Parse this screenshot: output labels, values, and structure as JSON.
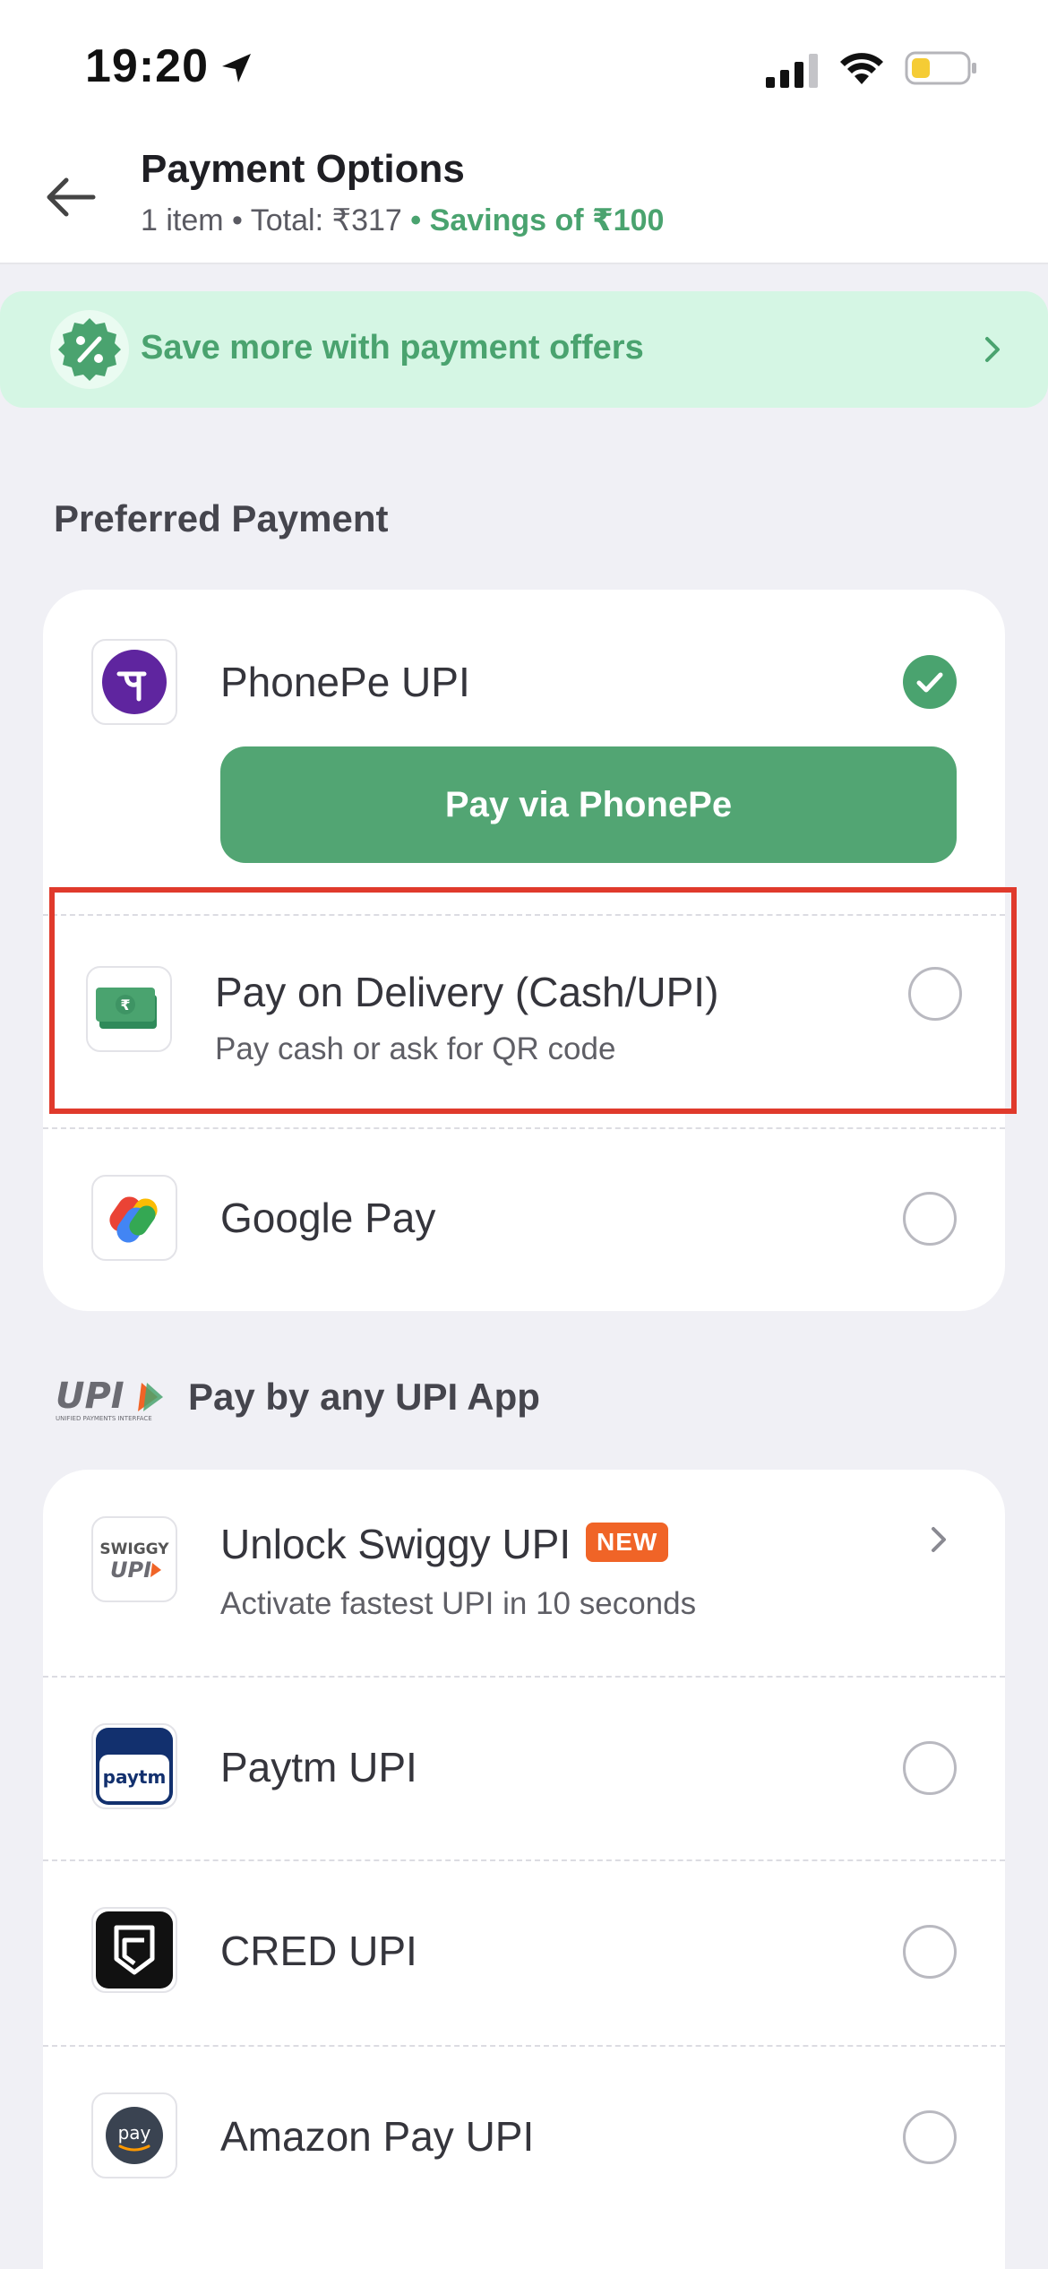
{
  "status_bar": {
    "time": "19:20"
  },
  "header": {
    "title": "Payment Options",
    "subtitle": "1 item • Total: ₹317",
    "savings": " • Savings of ₹100"
  },
  "offers_banner": {
    "text": "Save more with payment offers"
  },
  "preferred": {
    "section_title": "Preferred Payment",
    "phonepe": {
      "label": "PhonePe UPI",
      "button": "Pay via PhonePe"
    },
    "pod": {
      "label": "Pay on Delivery (Cash/UPI)",
      "sub": "Pay cash or ask for QR code"
    },
    "gpay": {
      "label": "Google Pay"
    }
  },
  "upi": {
    "section_title": "Pay by any UPI App",
    "upi_logo_text": "UPI",
    "upi_logo_sub": "UNIFIED PAYMENTS INTERFACE",
    "swiggy": {
      "label": "Unlock Swiggy UPI",
      "badge": "NEW",
      "sub": "Activate fastest UPI in 10 seconds",
      "logo_top": "SWIGGY",
      "logo_bottom": "UPI"
    },
    "paytm": {
      "label": "Paytm UPI",
      "logo": "paytm"
    },
    "cred": {
      "label": "CRED UPI"
    },
    "amazon": {
      "label": "Amazon Pay UPI",
      "logo": "pay"
    }
  },
  "colors": {
    "accent_green": "#4aa36f",
    "highlight_red": "#e03a2c",
    "badge_orange": "#f06427"
  }
}
